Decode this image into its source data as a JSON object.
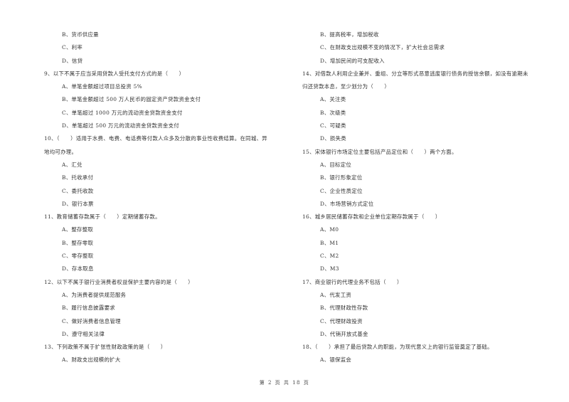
{
  "left_column": [
    {
      "type": "option",
      "text": "B、货币供应量"
    },
    {
      "type": "option",
      "text": "C、利率"
    },
    {
      "type": "option",
      "text": "D、信贷"
    },
    {
      "type": "question",
      "text": "9、以下不属于应当采用贷款人受托支付方式的是（　　）"
    },
    {
      "type": "option",
      "text": "A、单笔金额超过项目总投资 5%"
    },
    {
      "type": "option",
      "text": "B、单笔金额超过 500 万人民币的固定资产贷款资金支付"
    },
    {
      "type": "option",
      "text": "C、单笔超过 1000 万元的流动资金贷款资金支付"
    },
    {
      "type": "option",
      "text": "D、单笔超过 500 万元的流动资金贷款资金支付"
    },
    {
      "type": "question",
      "text": "10、（　　）适用于水费、电费、电话费等付款人众多及分散的事业性收费结算。在同城、异"
    },
    {
      "type": "question-cont",
      "text": "地均可办理。"
    },
    {
      "type": "option",
      "text": "A、汇兑"
    },
    {
      "type": "option",
      "text": "B、托收承付"
    },
    {
      "type": "option",
      "text": "C、委托收款"
    },
    {
      "type": "option",
      "text": "D、银行本票"
    },
    {
      "type": "question",
      "text": "11、教育储蓄存款属于（　　）定期储蓄存款。"
    },
    {
      "type": "option",
      "text": "A、整存整取"
    },
    {
      "type": "option",
      "text": "B、整存零取"
    },
    {
      "type": "option",
      "text": "C、零存整取"
    },
    {
      "type": "option",
      "text": "D、存本取息"
    },
    {
      "type": "question",
      "text": "12、以下不属于银行业消费者权益保护主要内容的是（　　）"
    },
    {
      "type": "option",
      "text": "A、为消费者提供规范服务"
    },
    {
      "type": "option",
      "text": "B、履行信息披露要求"
    },
    {
      "type": "option",
      "text": "C、做好消费者信息管理"
    },
    {
      "type": "option",
      "text": "D、遵守相关法律"
    },
    {
      "type": "question",
      "text": "13、下列政策不属于扩张性财政政策的是（　　）"
    },
    {
      "type": "option",
      "text": "A、财政支出规模的扩大"
    }
  ],
  "right_column": [
    {
      "type": "option",
      "text": "B、提高税率，增加税收"
    },
    {
      "type": "option",
      "text": "C、在财政支出规模不变的情况下，扩大社会总需求"
    },
    {
      "type": "option",
      "text": "D、增加民间的可支配收入"
    },
    {
      "type": "question",
      "text": "14、对借款人利用企业兼并、重组、分立等形式恶意逃废银行债务的授信余额，如没有逾期未"
    },
    {
      "type": "question-cont",
      "text": "归还贷款本息，至少划分为（　　）"
    },
    {
      "type": "option",
      "text": "A、关注类"
    },
    {
      "type": "option",
      "text": "B、次级类"
    },
    {
      "type": "option",
      "text": "C、可疑类"
    },
    {
      "type": "option",
      "text": "D、损失类"
    },
    {
      "type": "question",
      "text": "15、宋体银行市场定位主要包括产品定位和（　　）两个方面。"
    },
    {
      "type": "option",
      "text": "A、目标定位"
    },
    {
      "type": "option",
      "text": "B、银行形象定位"
    },
    {
      "type": "option",
      "text": "C、企业性质定位"
    },
    {
      "type": "option",
      "text": "D、市场营销方式定位"
    },
    {
      "type": "question",
      "text": "16、城乡居民储蓄存款和企业单位定期存款属于（　　）"
    },
    {
      "type": "option",
      "text": "A、M0"
    },
    {
      "type": "option",
      "text": "B、M1"
    },
    {
      "type": "option",
      "text": "C、M2"
    },
    {
      "type": "option",
      "text": "D、M3"
    },
    {
      "type": "question",
      "text": "17、商业银行的代理业务不包括（　　）"
    },
    {
      "type": "option",
      "text": "A、代发工资"
    },
    {
      "type": "option",
      "text": "B、代理财政性存款"
    },
    {
      "type": "option",
      "text": "C、代理财政投资"
    },
    {
      "type": "option",
      "text": "D、代销开放式基金"
    },
    {
      "type": "question",
      "text": "18、（　　）承担了最后贷款人的职能，为现代意义上的银行监管奠定了基础。"
    },
    {
      "type": "option",
      "text": "A、银保监会"
    }
  ],
  "footer": {
    "page_label": "第 2 页 共 18 页"
  }
}
